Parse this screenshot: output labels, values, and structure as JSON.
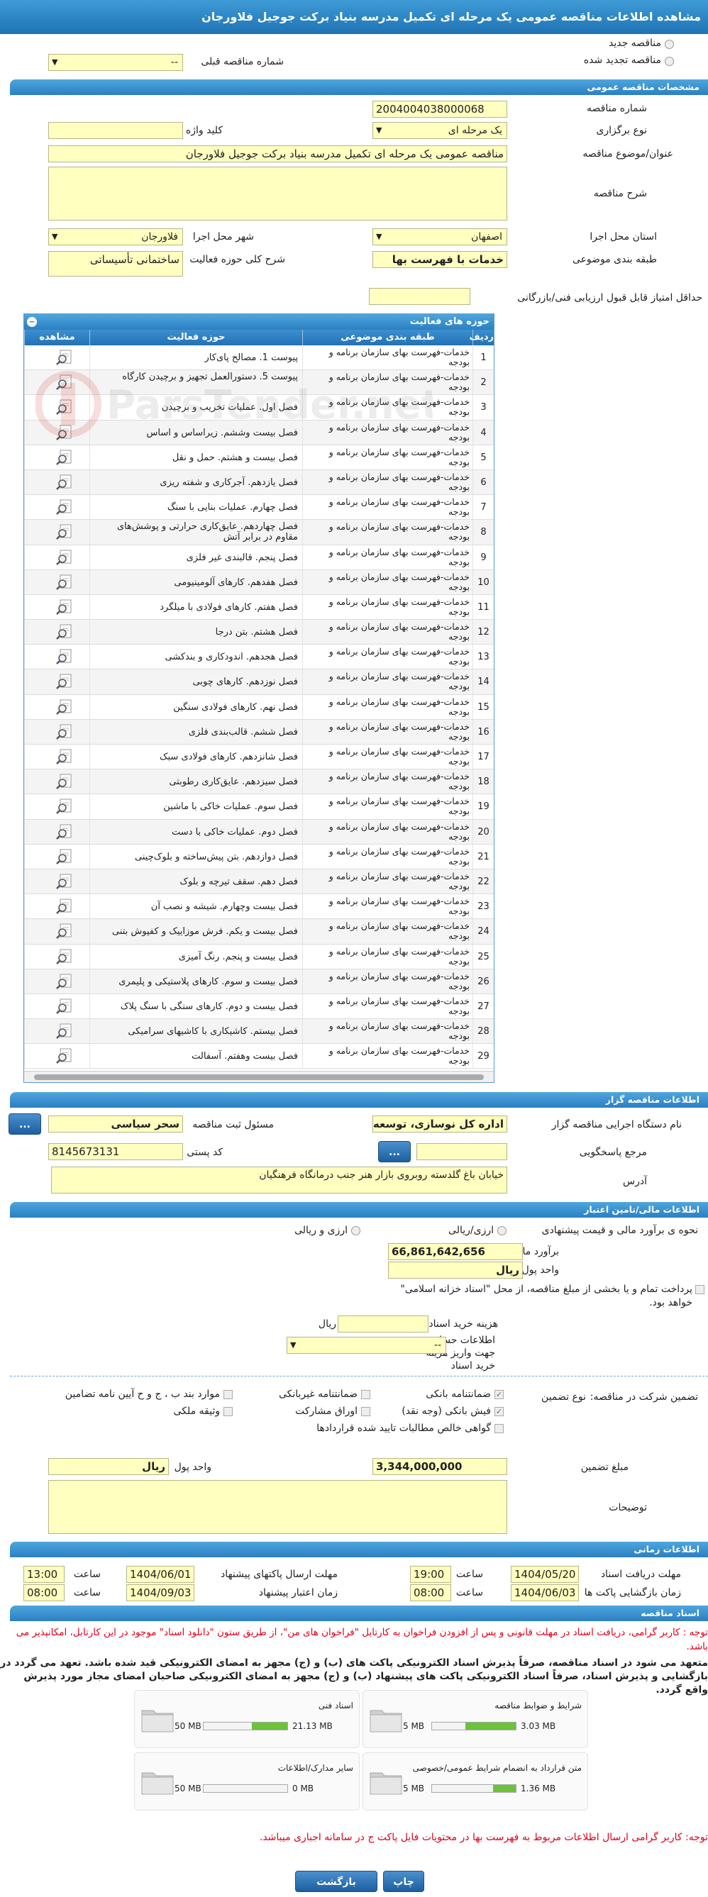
{
  "header": {
    "title": "مشاهده اطلاعات مناقصه عمومی یک مرحله ای تکمیل مدرسه بنیاد برکت جوجیل فلاورجان"
  },
  "top": {
    "new_tender": "مناقصه جدید",
    "renewed_tender": "مناقصه تجدید شده",
    "prev_number_label": "شماره مناقصه قبلی",
    "prev_number_value": "--"
  },
  "general": {
    "section": "مشخصات مناقصه عمومی",
    "number_label": "شماره مناقصه",
    "number_value": "2004004038000068",
    "type_label": "نوع برگزاری",
    "type_value": "یک مرحله ای",
    "keyword_label": "کلید واژه",
    "keyword_value": "",
    "title_label": "عنوان/موضوع مناقصه",
    "title_value": "مناقصه عمومی یک مرحله ای تکمیل مدرسه بنیاد برکت جوجیل فلاورجان",
    "desc_label": "شرح مناقصه",
    "province_label": "استان محل اجرا",
    "province_value": "اصفهان",
    "city_label": "شهر محل اجرا",
    "city_value": "فلاورجان",
    "category_label": "طبقه بندی موضوعی",
    "category_value": "خدمات با فهرست بها",
    "scope_label": "شرح کلی حوزه فعالیت",
    "scope_value": "ساختمانی تأسیساتی",
    "min_score_label": "حداقل امتیاز قابل قبول ارزیابی فنی/بازرگانی",
    "min_score_value": ""
  },
  "activities": {
    "title": "حوزه های فعالیت",
    "collapse": "−",
    "headers": [
      "ردیف",
      "طبقه بندی موضوعی",
      "حوزه فعالیت",
      "مشاهده"
    ],
    "rows": [
      {
        "n": "1",
        "cat": "خدمات-فهرست بهای سازمان برنامه و بودجه",
        "act": "پیوست 1. مصالح پای‌کار"
      },
      {
        "n": "2",
        "cat": "خدمات-فهرست بهای سازمان برنامه و بودجه",
        "act": "پیوست 5. دستورالعمل تجهیز و برچیدن کارگاه"
      },
      {
        "n": "3",
        "cat": "خدمات-فهرست بهای سازمان برنامه و بودجه",
        "act": "فصل اول. عملیات تخریب و برچیدن"
      },
      {
        "n": "4",
        "cat": "خدمات-فهرست بهای سازمان برنامه و بودجه",
        "act": "فصل بیست وششم. زیراساس و اساس"
      },
      {
        "n": "5",
        "cat": "خدمات-فهرست بهای سازمان برنامه و بودجه",
        "act": "فصل بیست و هشتم. حمل و نقل"
      },
      {
        "n": "6",
        "cat": "خدمات-فهرست بهای سازمان برنامه و بودجه",
        "act": "فصل یازدهم. آجرکاری و شفته ریزی"
      },
      {
        "n": "7",
        "cat": "خدمات-فهرست بهای سازمان برنامه و بودجه",
        "act": "فصل چهارم. عملیات بنایی با سنگ"
      },
      {
        "n": "8",
        "cat": "خدمات-فهرست بهای سازمان برنامه و بودجه",
        "act": "فصل چهاردهم. عایق‌کاری حرارتی و پوشش‌های مقاوم در برابر آتش"
      },
      {
        "n": "9",
        "cat": "خدمات-فهرست بهای سازمان برنامه و بودجه",
        "act": "فصل پنجم. قالبندی غیر فلزی"
      },
      {
        "n": "10",
        "cat": "خدمات-فهرست بهای سازمان برنامه و بودجه",
        "act": "فصل هفدهم. کارهای آلومینیومی"
      },
      {
        "n": "11",
        "cat": "خدمات-فهرست بهای سازمان برنامه و بودجه",
        "act": "فصل هفتم. کارهای فولادی با میلگرد"
      },
      {
        "n": "12",
        "cat": "خدمات-فهرست بهای سازمان برنامه و بودجه",
        "act": "فصل هشتم. بتن درجا"
      },
      {
        "n": "13",
        "cat": "خدمات-فهرست بهای سازمان برنامه و بودجه",
        "act": "فصل هجدهم. اندودکاری و بندکشی"
      },
      {
        "n": "14",
        "cat": "خدمات-فهرست بهای سازمان برنامه و بودجه",
        "act": "فصل نوزدهم. کارهای چوبی"
      },
      {
        "n": "15",
        "cat": "خدمات-فهرست بهای سازمان برنامه و بودجه",
        "act": "فصل نهم. کارهای فولادی سنگین"
      },
      {
        "n": "16",
        "cat": "خدمات-فهرست بهای سازمان برنامه و بودجه",
        "act": "فصل ششم. قالب‌بندی فلزی"
      },
      {
        "n": "17",
        "cat": "خدمات-فهرست بهای سازمان برنامه و بودجه",
        "act": "فصل شانزدهم. کارهای فولادی سبک"
      },
      {
        "n": "18",
        "cat": "خدمات-فهرست بهای سازمان برنامه و بودجه",
        "act": "فصل سیزدهم. عایق‌کاری رطوبتی"
      },
      {
        "n": "19",
        "cat": "خدمات-فهرست بهای سازمان برنامه و بودجه",
        "act": "فصل سوم. عملیات خاکی با ماشین"
      },
      {
        "n": "20",
        "cat": "خدمات-فهرست بهای سازمان برنامه و بودجه",
        "act": "فصل دوم. عملیات خاکی با دست"
      },
      {
        "n": "21",
        "cat": "خدمات-فهرست بهای سازمان برنامه و بودجه",
        "act": "فصل دوازدهم. بتن پیش‌ساخته و بلوک‌چینی"
      },
      {
        "n": "22",
        "cat": "خدمات-فهرست بهای سازمان برنامه و بودجه",
        "act": "فصل دهم. سقف تیرچه و بلوک"
      },
      {
        "n": "23",
        "cat": "خدمات-فهرست بهای سازمان برنامه و بودجه",
        "act": "فصل بیست وچهارم. شیشه و نصب آن"
      },
      {
        "n": "24",
        "cat": "خدمات-فهرست بهای سازمان برنامه و بودجه",
        "act": "فصل بیست و یکم. فرش موزاییک و کفپوش بتنی"
      },
      {
        "n": "25",
        "cat": "خدمات-فهرست بهای سازمان برنامه و بودجه",
        "act": "فصل بیست و پنجم. رنگ آمیزی"
      },
      {
        "n": "26",
        "cat": "خدمات-فهرست بهای سازمان برنامه و بودجه",
        "act": "فصل بیست و سوم. کارهای پلاستیکی و پلیمری"
      },
      {
        "n": "27",
        "cat": "خدمات-فهرست بهای سازمان برنامه و بودجه",
        "act": "فصل بیست و دوم. کارهای سنگی با سنگ پلاک"
      },
      {
        "n": "28",
        "cat": "خدمات-فهرست بهای سازمان برنامه و بودجه",
        "act": "فصل بیستم. کاشیکاری با کاشیهای سرامیکی"
      },
      {
        "n": "29",
        "cat": "خدمات-فهرست بهای سازمان برنامه و بودجه",
        "act": "فصل بیست وهفتم. آسفالت"
      }
    ]
  },
  "organizer": {
    "section": "اطلاعات مناقصه گزار",
    "agency_label": "نام دستگاه اجرایی مناقصه گزار",
    "agency_value": "اداره کل نوسازی، توسعه و",
    "officer_label": "مسئول ثبت مناقصه",
    "officer_value": "سحر سیاسی",
    "ref_label": "مرجع پاسخگویی",
    "ref_value": "",
    "postal_label": "کد پستی",
    "postal_value": "8145673131",
    "address_label": "آدرس",
    "address_value": "خیابان باغ گلدسته روبروی بازار هنر جنب درمانگاه فرهنگیان",
    "more": "..."
  },
  "financial": {
    "section": "اطلاعات مالی/تامین اعتبار",
    "estimate_method_label": "نحوه ی برآورد مالی و قیمت پیشنهادی",
    "opt_rial": "ارزی/ریالی",
    "opt_fx": "ارزی و ریالی",
    "estimate_label": "برآورد مالی",
    "estimate_value": "66,861,642,656",
    "currency_label": "واحد پول",
    "currency_value": "ریال",
    "treasury_note": "پرداخت تمام و یا بخشی از مبلغ مناقصه، از محل \"اسناد خزانه اسلامی\" خواهد بود.",
    "doc_fee_label": "هزینه خرید اسناد",
    "doc_fee_unit": "ریال",
    "account_label": "اطلاعات حساب جهت واریز هزینه خرید اسناد",
    "account_value": "--"
  },
  "guarantee": {
    "label": "تضمین شرکت در مناقصه:",
    "type_label": "نوع تضمین",
    "options": [
      "ضمانتنامه بانکی",
      "ضمانتنامه غیربانکی",
      "موارد بند ب ، ج و ح آیین نامه تضامین",
      "فیش بانکی (وجه نقد)",
      "اوراق مشارکت",
      "وثیقه ملکی",
      "گواهی خالص مطالبات تایید شده قراردادها"
    ],
    "amount_label": "مبلغ تضمین",
    "amount_value": "3,344,000,000",
    "currency_label": "واحد پول",
    "currency_value": "ریال",
    "notes_label": "توضیحات"
  },
  "timing": {
    "section": "اطلاعات زمانی",
    "receive_deadline_label": "مهلت دریافت اسناد",
    "receive_deadline_date": "1404/05/20",
    "receive_deadline_time": "19:00",
    "send_deadline_label": "مهلت ارسال پاکتهای پیشنهاد",
    "send_deadline_date": "1404/06/01",
    "send_deadline_time": "13:00",
    "opening_label": "زمان بازگشایی پاکت ها",
    "opening_date": "1404/06/03",
    "opening_time": "08:00",
    "validity_label": "زمان اعتبار پیشنهاد",
    "validity_date": "1404/09/03",
    "validity_time": "08:00",
    "time_label": "ساعت"
  },
  "documents": {
    "section": "اسناد مناقصه",
    "note1": "توجه : کاربر گرامی، دریافت اسناد در مهلت قانونی و پس از افزودن فراخوان به کارتابل \"فراخوان های من\"، از طریق ستون \"دانلود اسناد\" موجود در این کارتابل، امکانپذیر می باشد.",
    "note2": "متعهد می شود در اسناد مناقصه، صرفاً پذیرش اسناد الکترونیکی پاکت های (ب) و (ج) مجهز به امضای الکترونیکی قید شده باشد. تعهد می گردد در بازگشایی و پذیرش اسناد، صرفاً اسناد الکترونیکی پاکت های پیشنهاد (ب) و (ج) مجهز به امضای الکترونیکی صاحبان امضای مجاز مورد پذیرش واقع گردد.",
    "files": [
      {
        "name": "شرایط و ضوابط مناقصه",
        "size": "3.03 MB",
        "max": "5 MB",
        "fill": 0.6
      },
      {
        "name": "اسناد فنی",
        "size": "21.13 MB",
        "max": "50 MB",
        "fill": 0.42
      },
      {
        "name": "متن قرارداد به انضمام شرایط عمومی/خصوصی",
        "size": "1.36 MB",
        "max": "5 MB",
        "fill": 0.27
      },
      {
        "name": "سایر مدارک/اطلاعات",
        "size": "0 MB",
        "max": "50 MB",
        "fill": 0
      }
    ],
    "note3": "توجه: کاربر گرامی ارسال اطلاعات مربوط به فهرست بها در محتویات فایل پاکت ج در سامانه اجباری میباشد."
  },
  "footer": {
    "print": "چاپ",
    "back": "بازگشت"
  },
  "watermark": "ParsTender.net"
}
